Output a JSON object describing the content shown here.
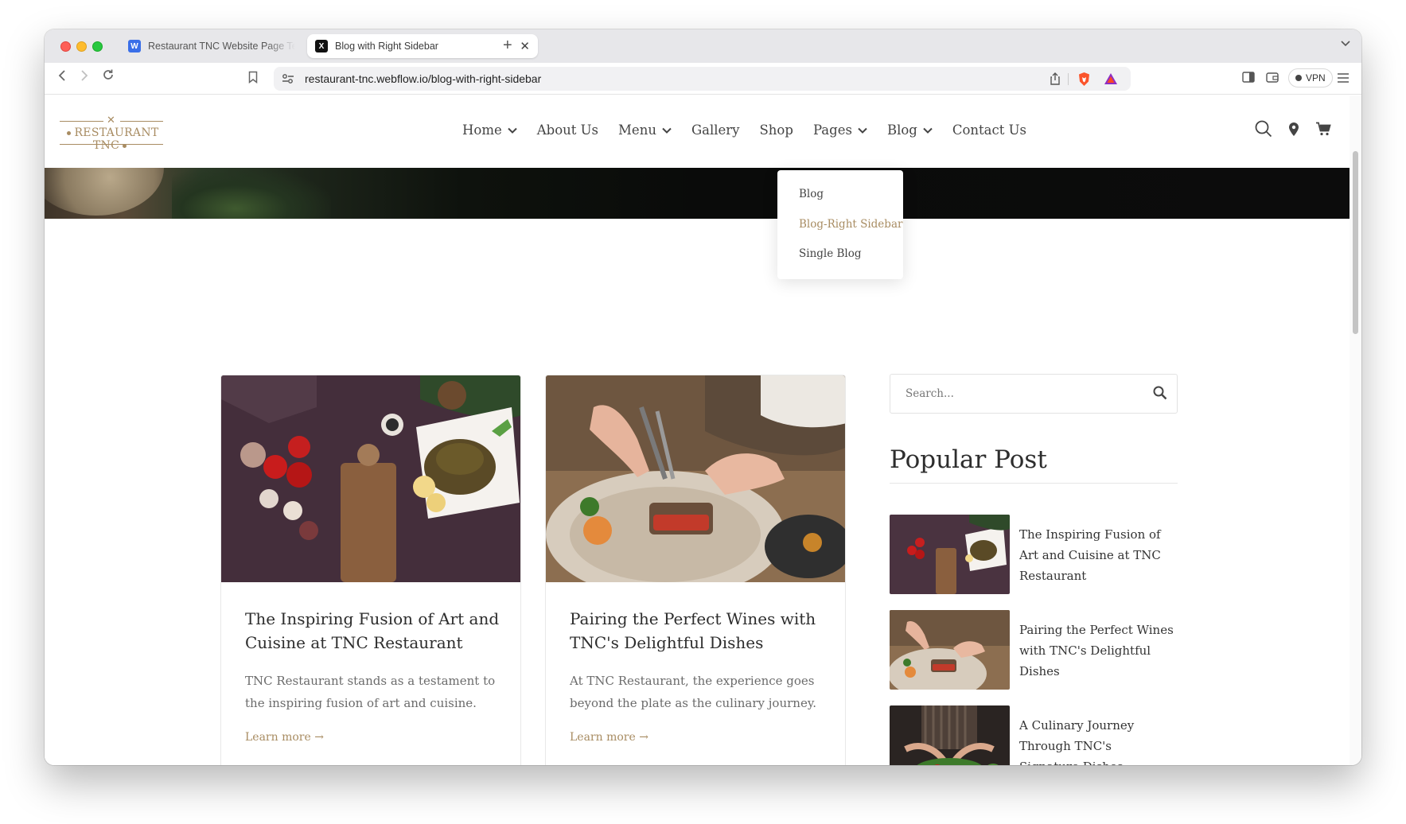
{
  "browser": {
    "tabs": [
      {
        "title": "Restaurant TNC Website Page Te",
        "favicon": "W",
        "active": false
      },
      {
        "title": "Blog with Right Sidebar",
        "favicon": "X",
        "active": true
      }
    ],
    "url": "restaurant-tnc.webflow.io/blog-with-right-sidebar",
    "vpn_label": "VPN"
  },
  "site": {
    "logo_text": "RESTAURANT TNC",
    "accent_color": "#a88c62",
    "nav": [
      {
        "label": "Home",
        "has_dropdown": true
      },
      {
        "label": "About Us",
        "has_dropdown": false
      },
      {
        "label": "Menu",
        "has_dropdown": true
      },
      {
        "label": "Gallery",
        "has_dropdown": false
      },
      {
        "label": "Shop",
        "has_dropdown": false
      },
      {
        "label": "Pages",
        "has_dropdown": true
      },
      {
        "label": "Blog",
        "has_dropdown": true
      },
      {
        "label": "Contact Us",
        "has_dropdown": false
      }
    ],
    "blog_dropdown": [
      {
        "label": "Blog",
        "active": false
      },
      {
        "label": "Blog-Right Sidebar",
        "active": true
      },
      {
        "label": "Single Blog",
        "active": false
      }
    ]
  },
  "posts": [
    {
      "title": "The Inspiring Fusion of Art and Cuisine at TNC Restaurant",
      "excerpt": "TNC Restaurant stands as a testament to the inspiring fusion of art and cuisine.",
      "link": "Learn more →"
    },
    {
      "title": "Pairing the Perfect Wines with TNC's Delightful Dishes",
      "excerpt": "At TNC Restaurant, the experience goes beyond the plate as the culinary journey.",
      "link": "Learn more →"
    }
  ],
  "sidebar": {
    "search_placeholder": "Search...",
    "popular_title": "Popular Post",
    "popular_posts": [
      {
        "title": "The Inspiring Fusion of Art and Cuisine at TNC Restaurant"
      },
      {
        "title": "Pairing the Perfect Wines with TNC's Delightful Dishes"
      },
      {
        "title": "A Culinary Journey Through TNC's Signature Dishes"
      }
    ]
  }
}
